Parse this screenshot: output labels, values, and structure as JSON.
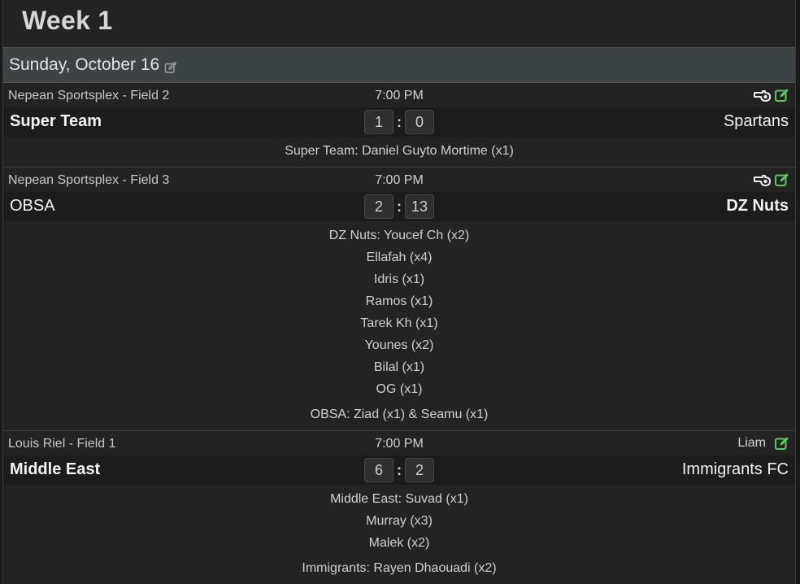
{
  "week": {
    "title": "Week 1"
  },
  "day": {
    "label": "Sunday, October 16"
  },
  "colors": {
    "accent_green": "#5cc95c",
    "icon_white": "#eaeaea",
    "day_bar": "#3d4244"
  },
  "icons": {
    "edit": "pencil-square-icon",
    "watch": "whistle-icon"
  },
  "games": [
    {
      "location": "Nepean Sportsplex - Field 2",
      "time": "7:00 PM",
      "home": "Super Team",
      "away": "Spartans",
      "home_score": "1",
      "away_score": "0",
      "scorer_groups": [
        [
          "Super Team: Daniel Guyto Mortime (x1)"
        ]
      ]
    },
    {
      "location": "Nepean Sportsplex - Field 3",
      "time": "7:00 PM",
      "home": "OBSA",
      "away": "DZ Nuts",
      "home_score": "2",
      "away_score": "13",
      "scorer_groups": [
        [
          "DZ Nuts: Youcef Ch (x2)",
          "Ellafah (x4)",
          "Idris (x1)",
          "Ramos (x1)",
          "Tarek Kh (x1)",
          "Younes (x2)",
          "Bilal (x1)",
          "OG (x1)"
        ],
        [
          "OBSA: Ziad (x1) & Seamu (x1)"
        ]
      ]
    },
    {
      "location": "Louis Riel - Field 1",
      "time": "7:00 PM",
      "referee": "Liam",
      "home": "Middle East",
      "away": "Immigrants FC",
      "home_score": "6",
      "away_score": "2",
      "scorer_groups": [
        [
          "Middle East: Suvad (x1)",
          "Murray (x3)",
          "Malek (x2)"
        ],
        [
          "Immigrants: Rayen Dhaouadi (x2)"
        ]
      ]
    }
  ]
}
